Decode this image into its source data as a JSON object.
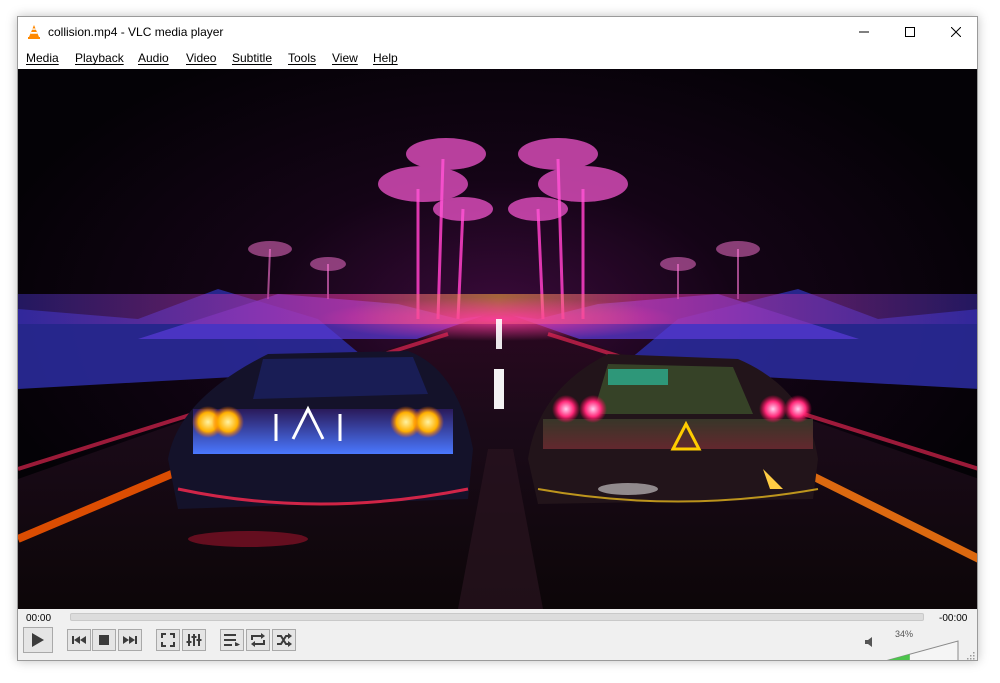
{
  "window": {
    "title": "collision.mp4 - VLC media player",
    "accent": "#ff8800"
  },
  "menu": [
    {
      "label": "Media",
      "name": "menu-media"
    },
    {
      "label": "Playback",
      "name": "menu-playback"
    },
    {
      "label": "Audio",
      "name": "menu-audio"
    },
    {
      "label": "Video",
      "name": "menu-video"
    },
    {
      "label": "Subtitle",
      "name": "menu-subtitle"
    },
    {
      "label": "Tools",
      "name": "menu-tools"
    },
    {
      "label": "View",
      "name": "menu-view"
    },
    {
      "label": "Help",
      "name": "menu-help"
    }
  ],
  "player": {
    "elapsed": "00:00",
    "remaining": "-00:00",
    "progress": 0,
    "volume_label": "34%",
    "volume_level": 0.34
  },
  "controls": {
    "icons": [
      "play-icon",
      "previous-icon",
      "stop-icon",
      "next-icon",
      "fullscreen-icon",
      "extended-settings-icon",
      "playlist-icon",
      "loop-icon",
      "shuffle-icon",
      "speaker-icon"
    ]
  }
}
